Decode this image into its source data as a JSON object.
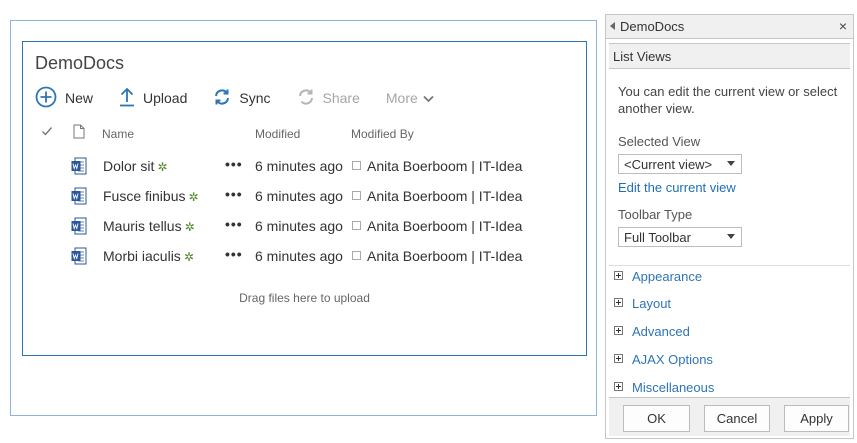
{
  "webpart": {
    "title": "DemoDocs",
    "commands": {
      "new": "New",
      "upload": "Upload",
      "sync": "Sync",
      "share": "Share",
      "more": "More"
    },
    "columns": {
      "name": "Name",
      "modified": "Modified",
      "modified_by": "Modified By"
    },
    "rows": [
      {
        "name": "Dolor sit",
        "modified": "6 minutes ago",
        "modified_by": "Anita Boerboom | IT-Idea"
      },
      {
        "name": "Fusce finibus",
        "modified": "6 minutes ago",
        "modified_by": "Anita Boerboom | IT-Idea"
      },
      {
        "name": "Mauris tellus",
        "modified": "6 minutes ago",
        "modified_by": "Anita Boerboom | IT-Idea"
      },
      {
        "name": "Morbi iaculis",
        "modified": "6 minutes ago",
        "modified_by": "Anita Boerboom | IT-Idea"
      }
    ],
    "new_indicator": "✲",
    "ellipsis": "•••",
    "dropzone": "Drag files here to upload"
  },
  "toolpane": {
    "title": "DemoDocs",
    "close": "×",
    "section": "List Views",
    "description": "You can edit the current view or select another view.",
    "selected_view_label": "Selected View",
    "selected_view_value": "<Current view>",
    "edit_link": "Edit the current view",
    "toolbar_type_label": "Toolbar Type",
    "toolbar_type_value": "Full Toolbar",
    "categories": [
      "Appearance",
      "Layout",
      "Advanced",
      "AJAX Options",
      "Miscellaneous"
    ],
    "buttons": {
      "ok": "OK",
      "cancel": "Cancel",
      "apply": "Apply"
    }
  },
  "colors": {
    "accent": "#2e75b6",
    "new_indicator": "#4e8a25",
    "word_icon": "#2b579a"
  }
}
